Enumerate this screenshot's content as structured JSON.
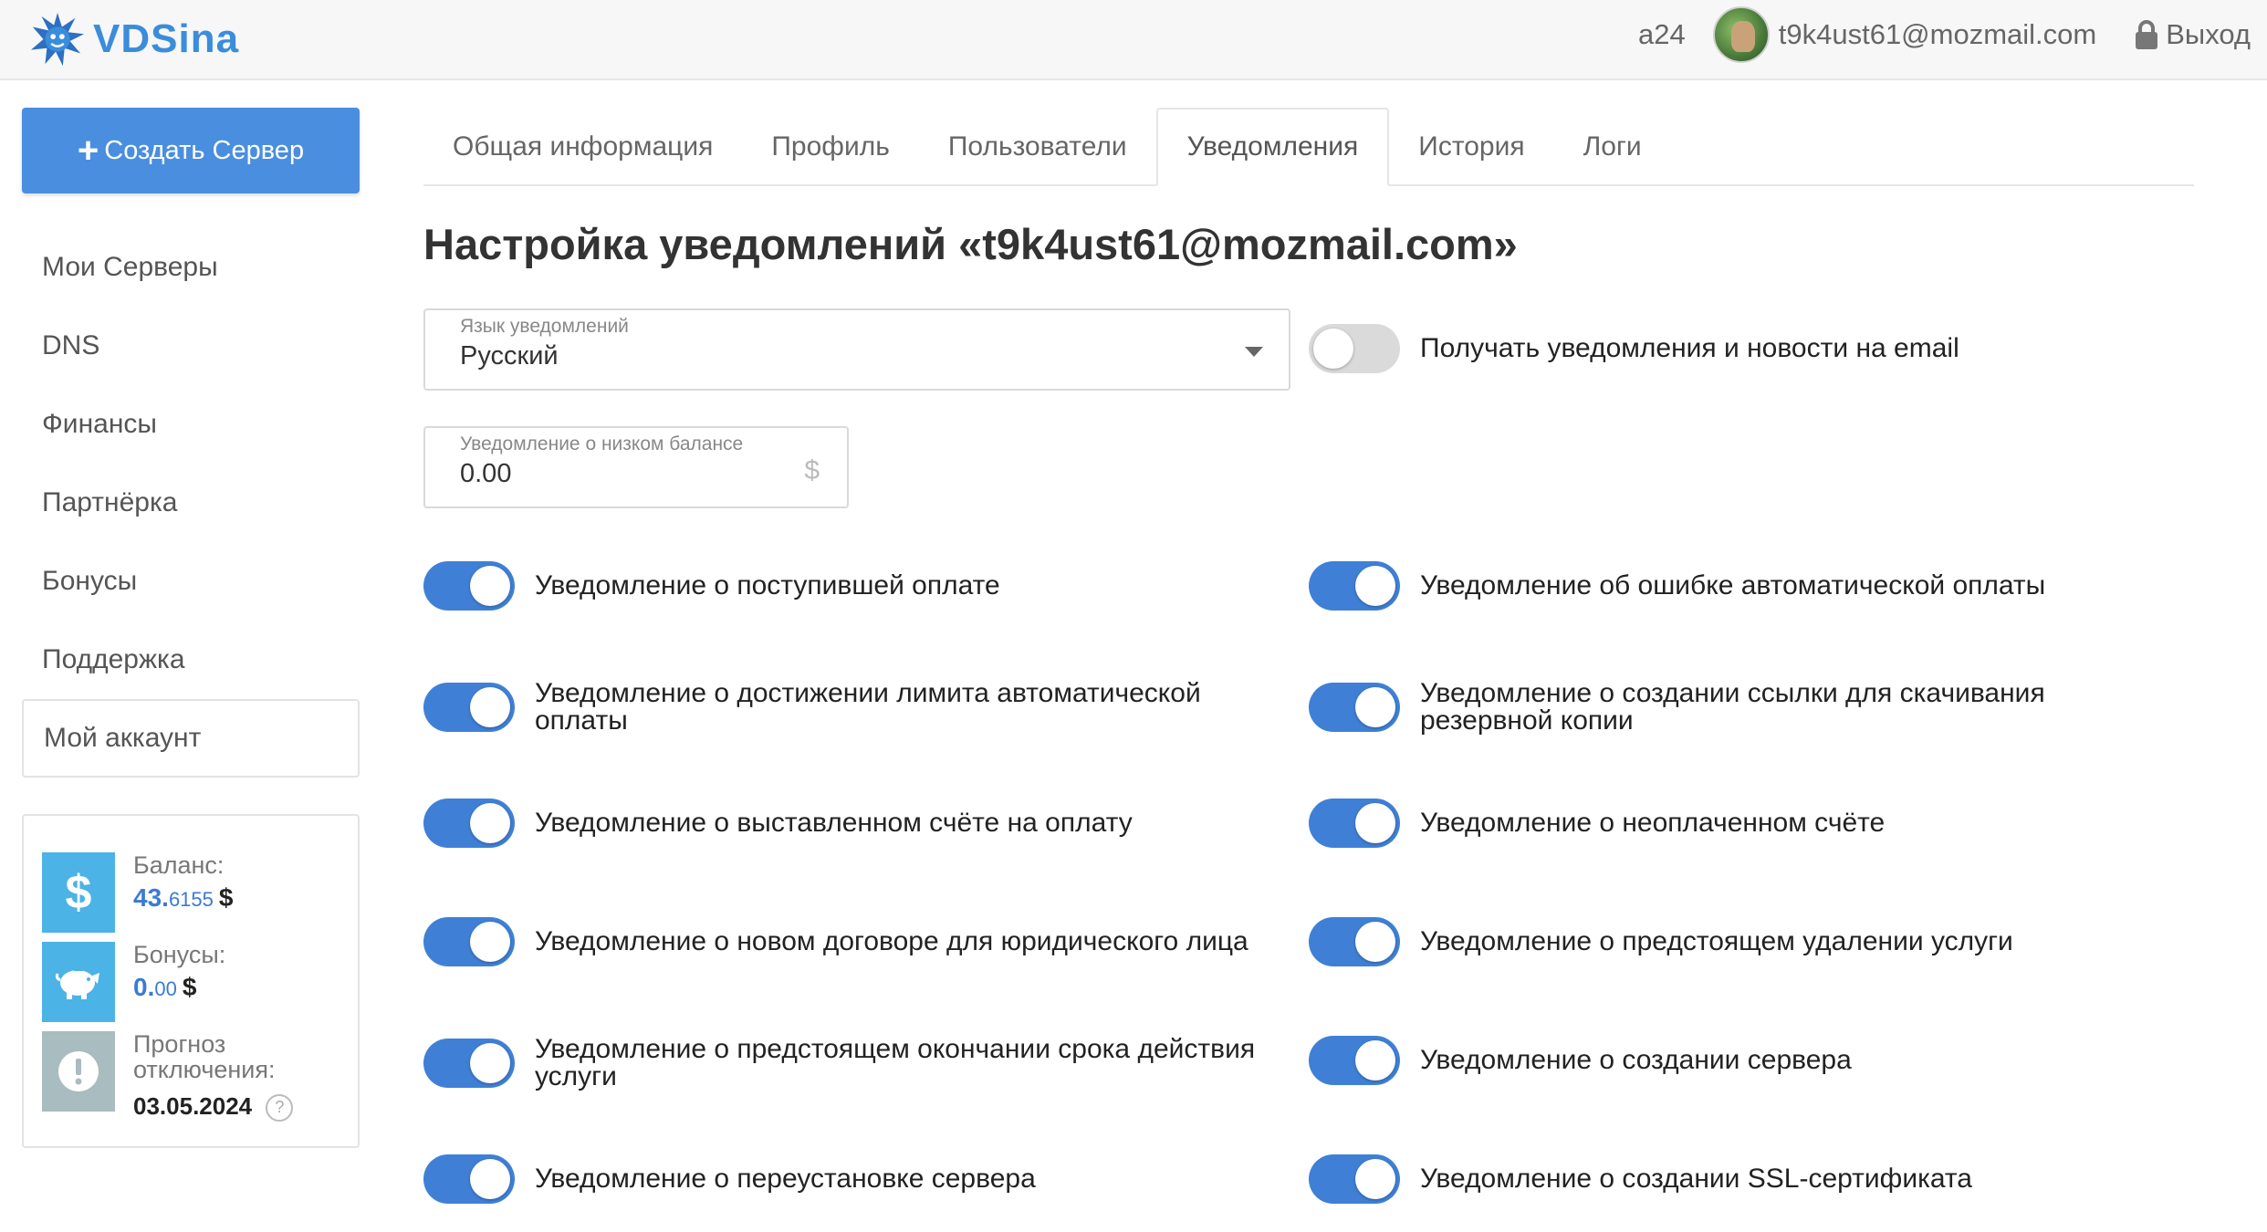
{
  "header": {
    "logo_text": "VDSina",
    "account_id": "a24",
    "user_email": "t9k4ust61@mozmail.com",
    "logout_label": "Выход"
  },
  "sidebar": {
    "create_button_label": "Создать Сервер",
    "items": [
      {
        "label": "Мои Серверы"
      },
      {
        "label": "DNS"
      },
      {
        "label": "Финансы"
      },
      {
        "label": "Партнёрка"
      },
      {
        "label": "Бонусы"
      },
      {
        "label": "Поддержка"
      },
      {
        "label": "Мой аккаунт"
      }
    ],
    "balance": {
      "balance_label": "Баланс:",
      "balance_main": "43.",
      "balance_fraction": "6155",
      "balance_currency": "$",
      "bonus_label": "Бонусы:",
      "bonus_main": "0.",
      "bonus_fraction": "00",
      "bonus_currency": "$",
      "forecast_label_1": "Прогноз",
      "forecast_label_2": "отключения:",
      "forecast_date": "03.05.2024",
      "help_glyph": "?"
    }
  },
  "tabs": [
    {
      "label": "Общая информация"
    },
    {
      "label": "Профиль"
    },
    {
      "label": "Пользователи"
    },
    {
      "label": "Уведомления",
      "active": true
    },
    {
      "label": "История"
    },
    {
      "label": "Логи"
    }
  ],
  "page": {
    "title": "Настройка уведомлений «t9k4ust61@mozmail.com»",
    "language_field": {
      "label": "Язык уведомлений",
      "value": "Русский"
    },
    "email_news_toggle": {
      "label": "Получать уведомления и новости на email",
      "on": false
    },
    "low_balance_field": {
      "label": "Уведомление о низком балансе",
      "value": "0.00",
      "suffix": "$"
    },
    "toggles_left": [
      {
        "label": "Уведомление о поступившей оплате",
        "on": true
      },
      {
        "label": "Уведомление о достижении лимита автоматической оплаты",
        "on": true
      },
      {
        "label": "Уведомление о выставленном счёте на оплату",
        "on": true
      },
      {
        "label": "Уведомление о новом договоре для юридического лица",
        "on": true
      },
      {
        "label": "Уведомление о предстоящем окончании срока действия услуги",
        "on": true
      },
      {
        "label": "Уведомление о переустановке сервера",
        "on": true
      }
    ],
    "toggles_right": [
      {
        "label": "Уведомление об ошибке автоматической оплаты",
        "on": true
      },
      {
        "label": "Уведомление о создании ссылки для скачивания резервной копии",
        "on": true
      },
      {
        "label": "Уведомление о неоплаченном счёте",
        "on": true
      },
      {
        "label": "Уведомление о предстоящем удалении услуги",
        "on": true
      },
      {
        "label": "Уведомление о создании сервера",
        "on": true
      },
      {
        "label": "Уведомление о создании SSL-сертификата",
        "on": true
      }
    ]
  },
  "colors": {
    "accent": "#3f80d6",
    "create_button": "#4a8ee0",
    "balance_icon": "#4bb3e6",
    "warning_icon": "#a9bcbf"
  }
}
